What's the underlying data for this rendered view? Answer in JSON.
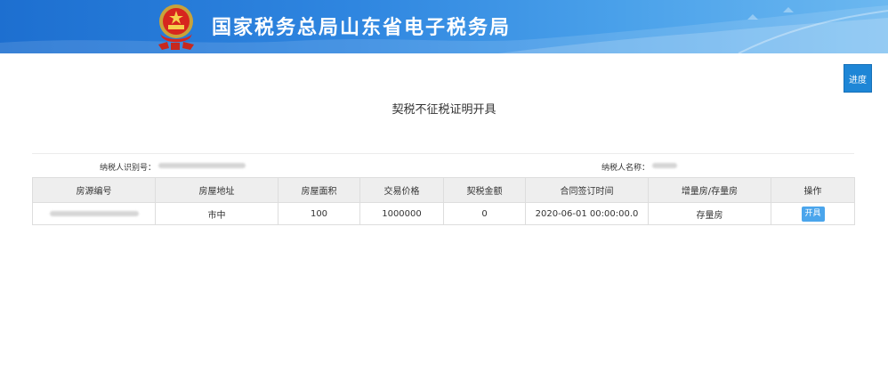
{
  "header": {
    "title": "国家税务总局山东省电子税务局"
  },
  "toolbar": {
    "progress_label": "进度"
  },
  "page": {
    "title": "契税不征税证明开具"
  },
  "taxpayer": {
    "id_label": "纳税人识别号：",
    "name_label": "纳税人名称："
  },
  "table": {
    "headers": [
      "房源编号",
      "房屋地址",
      "房屋面积",
      "交易价格",
      "契税金额",
      "合同签订时间",
      "增量房/存量房",
      "操作"
    ],
    "rows": [
      {
        "address": "市中",
        "area": "100",
        "price": "1000000",
        "tax": "0",
        "contract_time": "2020-06-01 00:00:00.0",
        "house_type": "存量房",
        "action_label": "开具"
      }
    ]
  },
  "colors": {
    "banner_start": "#1d6fd0",
    "banner_end": "#6cb8f0",
    "button_blue": "#1e86d6",
    "action_blue": "#4aa5ec",
    "table_header_bg": "#eeeeee"
  }
}
